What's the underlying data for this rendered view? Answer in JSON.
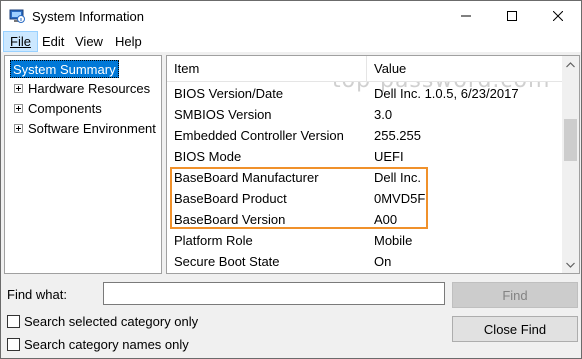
{
  "window": {
    "title": "System Information"
  },
  "menu": {
    "file": "File",
    "edit": "Edit",
    "view": "View",
    "help": "Help"
  },
  "tree": {
    "root": "System Summary",
    "children": [
      "Hardware Resources",
      "Components",
      "Software Environment"
    ]
  },
  "list": {
    "headers": {
      "item": "Item",
      "value": "Value"
    },
    "rows": [
      {
        "item": "BIOS Version/Date",
        "value": "Dell Inc. 1.0.5, 6/23/2017"
      },
      {
        "item": "SMBIOS Version",
        "value": "3.0"
      },
      {
        "item": "Embedded Controller Version",
        "value": "255.255"
      },
      {
        "item": "BIOS Mode",
        "value": "UEFI"
      },
      {
        "item": "BaseBoard Manufacturer",
        "value": "Dell Inc."
      },
      {
        "item": "BaseBoard Product",
        "value": "0MVD5F"
      },
      {
        "item": "BaseBoard Version",
        "value": "A00"
      },
      {
        "item": "Platform Role",
        "value": "Mobile"
      },
      {
        "item": "Secure Boot State",
        "value": "On"
      }
    ],
    "watermark": "top-password.com"
  },
  "find": {
    "label": "Find what:",
    "input_value": "",
    "find_button": "Find",
    "close_button": "Close Find",
    "search_selected": "Search selected category only",
    "search_names": "Search category names only"
  },
  "colors": {
    "highlight": "#f0912b",
    "selection": "#0078d7"
  }
}
